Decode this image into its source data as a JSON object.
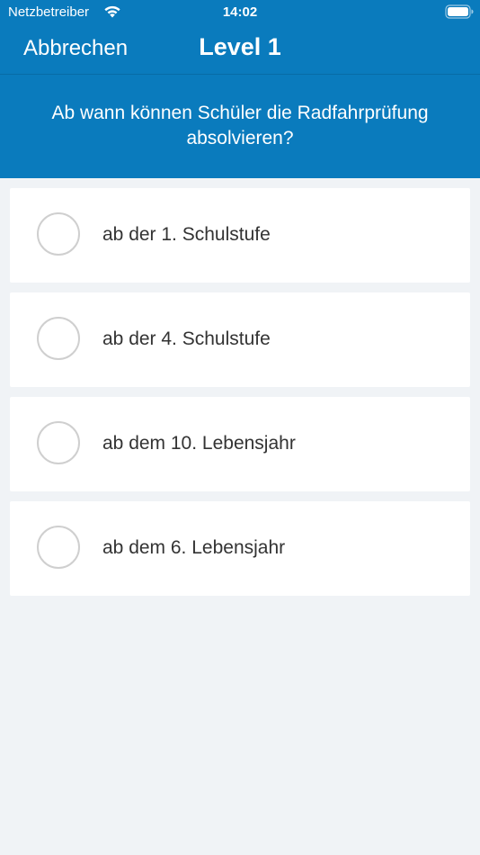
{
  "status_bar": {
    "carrier": "Netzbetreiber",
    "time": "14:02",
    "icons": [
      "wifi-icon",
      "battery-icon"
    ]
  },
  "nav": {
    "cancel_label": "Abbrechen",
    "title": "Level 1"
  },
  "question": {
    "text": "Ab wann können Schüler die Radfahrprüfung absolvieren?"
  },
  "answers": [
    {
      "label": "ab der 1. Schulstufe"
    },
    {
      "label": "ab der 4. Schulstufe"
    },
    {
      "label": "ab dem 10. Lebensjahr"
    },
    {
      "label": "ab dem 6. Lebensjahr"
    }
  ],
  "colors": {
    "header_blue": "#0a7bbd",
    "background": "#f0f3f6",
    "card": "#ffffff",
    "radio_border": "#cfcfcf",
    "answer_text": "#333333"
  }
}
